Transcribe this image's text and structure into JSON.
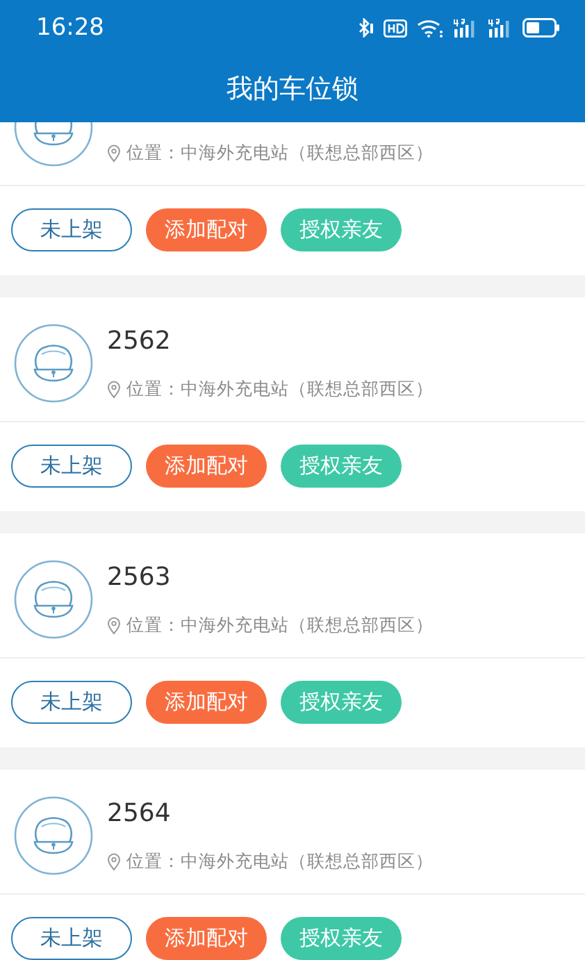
{
  "status_bar": {
    "time": "16:28"
  },
  "header": {
    "title": "我的车位锁"
  },
  "locks": [
    {
      "location": "位置：中海外充电站（联想总部西区）",
      "buttons": [
        {
          "label": "未上架",
          "kind": "outline"
        },
        {
          "label": "添加配对",
          "kind": "orange"
        },
        {
          "label": "授权亲友",
          "kind": "teal"
        }
      ]
    },
    {
      "number": "2562",
      "location": "位置：中海外充电站（联想总部西区）",
      "buttons": [
        {
          "label": "未上架",
          "kind": "outline"
        },
        {
          "label": "添加配对",
          "kind": "orange"
        },
        {
          "label": "授权亲友",
          "kind": "teal"
        }
      ]
    },
    {
      "number": "2563",
      "location": "位置：中海外充电站（联想总部西区）",
      "buttons": [
        {
          "label": "未上架",
          "kind": "outline"
        },
        {
          "label": "添加配对",
          "kind": "orange"
        },
        {
          "label": "授权亲友",
          "kind": "teal"
        }
      ]
    },
    {
      "number": "2564",
      "location": "位置：中海外充电站（联想总部西区）",
      "buttons": [
        {
          "label": "未上架",
          "kind": "outline"
        },
        {
          "label": "添加配对",
          "kind": "orange"
        },
        {
          "label": "授权亲友",
          "kind": "teal"
        }
      ]
    }
  ]
}
